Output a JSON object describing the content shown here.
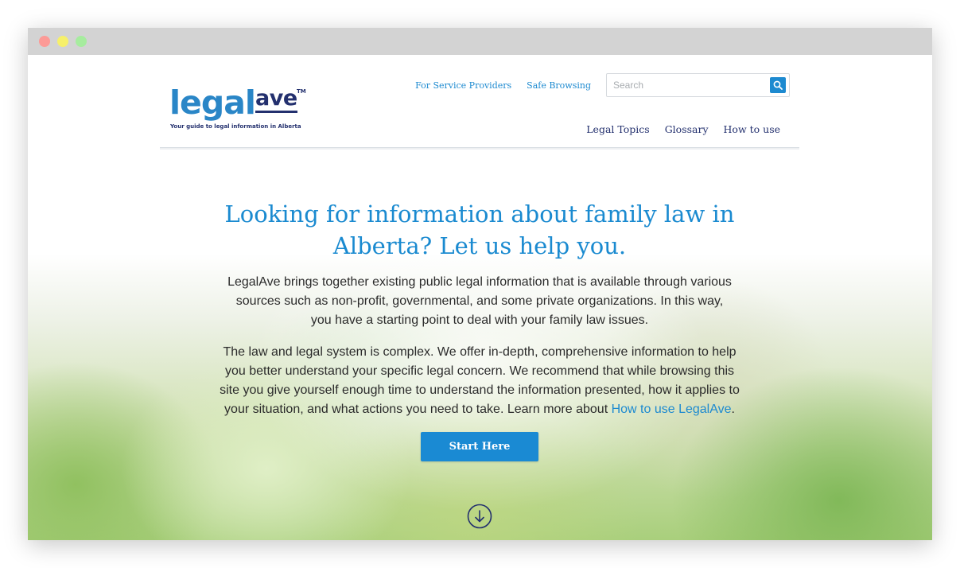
{
  "logo": {
    "word1": "legal",
    "word2": "ave",
    "tm": "TM",
    "tagline": "Your guide to legal information in Alberta"
  },
  "top_links": [
    "For Service Providers",
    "Safe Browsing"
  ],
  "search": {
    "placeholder": "Search",
    "icon": "search-icon"
  },
  "main_nav": [
    "Legal Topics",
    "Glossary",
    "How to use"
  ],
  "hero": {
    "title": "Looking for information about family law in Alberta? Let us help you.",
    "para1": "LegalAve brings together existing public legal information that is available through various sources such as non-profit, governmental, and some private organizations. In this way, you have a starting point to deal with your family law issues.",
    "para2": "The law and legal system is complex. We offer in-depth, comprehensive information to help you better understand your specific legal concern. We recommend that while browsing this site you give yourself enough time to understand the information presented, how it applies to your situation, and what actions you need to take. Learn more about ",
    "para2_link": "How to use LegalAve",
    "para2_end": ".",
    "cta": "Start Here",
    "scroll_icon": "arrow-down-circle-icon"
  },
  "colors": {
    "accent_blue": "#1a8ad0",
    "navy": "#23306e"
  }
}
